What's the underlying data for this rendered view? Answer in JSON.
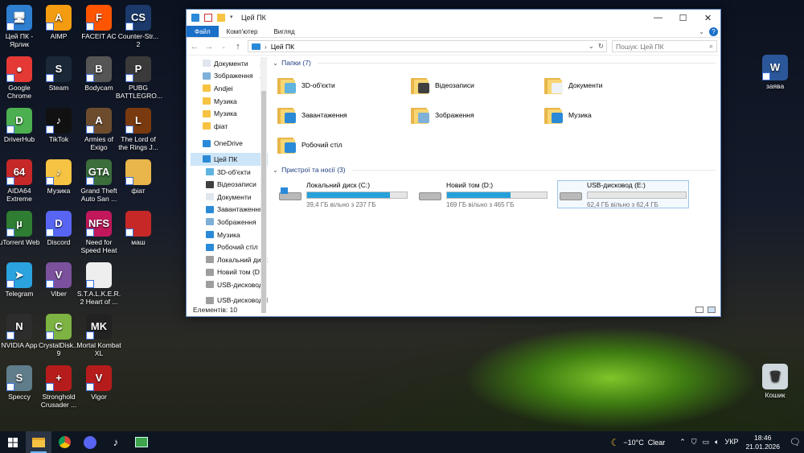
{
  "desktop": {
    "icons": [
      {
        "label": "Цей ПК - Ярлик",
        "color": "#2f7fd0",
        "glyph": "🖥"
      },
      {
        "label": "AIMP",
        "color": "#f39c12",
        "glyph": "A"
      },
      {
        "label": "FACEIT AC",
        "color": "#ff5500",
        "glyph": "F"
      },
      {
        "label": "Counter-Str... 2",
        "color": "#1b3a6b",
        "glyph": "CS"
      },
      {
        "label": "Google Chrome",
        "color": "#e53935",
        "glyph": "●"
      },
      {
        "label": "Steam",
        "color": "#1b2838",
        "glyph": "S"
      },
      {
        "label": "Bodycam",
        "color": "#555555",
        "glyph": "B"
      },
      {
        "label": "PUBG BATTLEGRO...",
        "color": "#3a3a3a",
        "glyph": "P"
      },
      {
        "label": "DriverHub",
        "color": "#4caf50",
        "glyph": "D"
      },
      {
        "label": "TikTok",
        "color": "#111111",
        "glyph": "♪"
      },
      {
        "label": "Armies of Exigo",
        "color": "#6d4c2e",
        "glyph": "A"
      },
      {
        "label": "The Lord of the Rings J...",
        "color": "#7a3a10",
        "glyph": "L"
      },
      {
        "label": "AIDA64 Extreme",
        "color": "#c62828",
        "glyph": "64"
      },
      {
        "label": "Музика",
        "color": "#f6c342",
        "glyph": "♪"
      },
      {
        "label": "Grand Theft Auto San ...",
        "color": "#3b6e3b",
        "glyph": "GTA"
      },
      {
        "label": "фіат",
        "color": "#e8b64a",
        "glyph": ""
      },
      {
        "label": "uTorrent Web",
        "color": "#2e7d32",
        "glyph": "µ"
      },
      {
        "label": "Discord",
        "color": "#5865f2",
        "glyph": "D"
      },
      {
        "label": "Need for Speed Heat",
        "color": "#c2185b",
        "glyph": "NFS"
      },
      {
        "label": "маш",
        "color": "#c62828",
        "glyph": ""
      },
      {
        "label": "Telegram",
        "color": "#2aa3df",
        "glyph": "➤"
      },
      {
        "label": "Viber",
        "color": "#7b519d",
        "glyph": "V"
      },
      {
        "label": "S.T.A.L.K.E.R. 2 Heart of ...",
        "color": "#eeeeee",
        "glyph": ""
      },
      {
        "label": "NVIDIA App",
        "color": "#2d2d2d",
        "glyph": "N"
      },
      {
        "label": "CrystalDisk... 9",
        "color": "#7cb342",
        "glyph": "C"
      },
      {
        "label": "Mortal Kombat XL",
        "color": "#222222",
        "glyph": "MK"
      },
      {
        "label": "Speccy",
        "color": "#607d8b",
        "glyph": "S"
      },
      {
        "label": "Stronghold Crusader ...",
        "color": "#b71c1c",
        "glyph": "+"
      },
      {
        "label": "Vigor",
        "color": "#b71c1c",
        "glyph": "V"
      },
      {
        "label": "заява",
        "color": "#2b579a",
        "glyph": "W"
      },
      {
        "label": "Кошик",
        "color": "#cfd8dc",
        "glyph": "🗑"
      }
    ]
  },
  "window": {
    "title": "Цей ПК",
    "tabs": [
      "Файл",
      "Комп'ютер",
      "Вигляд"
    ],
    "address": "Цей ПК",
    "search_placeholder": "Пошук: Цей ПК",
    "nav": [
      {
        "label": "Документи",
        "pinned": true,
        "color": "#dfe6ee"
      },
      {
        "label": "Зображення",
        "pinned": true,
        "color": "#7fb0d8"
      },
      {
        "label": "Andjei",
        "pinned": false,
        "color": "#f6c342"
      },
      {
        "label": "Музика",
        "pinned": false,
        "color": "#f6c342"
      },
      {
        "label": "Музика",
        "pinned": false,
        "color": "#f6c342"
      },
      {
        "label": "фіат",
        "pinned": false,
        "color": "#f6c342"
      },
      {
        "label": "OneDrive",
        "pinned": false,
        "color": "#2a8ad8"
      },
      {
        "label": "Цей ПК",
        "pinned": false,
        "color": "#2a8ad8"
      },
      {
        "label": "3D-об'єкти",
        "pinned": false,
        "color": "#5fb4e0"
      },
      {
        "label": "Відеозаписи",
        "pinned": false,
        "color": "#404040"
      },
      {
        "label": "Документи",
        "pinned": false,
        "color": "#dfe6ee"
      },
      {
        "label": "Завантаження",
        "pinned": false,
        "color": "#2a8ad8"
      },
      {
        "label": "Зображення",
        "pinned": false,
        "color": "#7fb0d8"
      },
      {
        "label": "Музика",
        "pinned": false,
        "color": "#2a8ad8"
      },
      {
        "label": "Робочий стіл",
        "pinned": false,
        "color": "#2a8ad8"
      },
      {
        "label": "Локальний диск",
        "pinned": false,
        "color": "#9e9e9e"
      },
      {
        "label": "Новий том (D:)",
        "pinned": false,
        "color": "#9e9e9e"
      },
      {
        "label": "USB-дисковод (",
        "pinned": false,
        "color": "#9e9e9e"
      },
      {
        "label": "USB-дисковод (E:)",
        "pinned": false,
        "color": "#9e9e9e"
      }
    ],
    "folders_header": "Папки (7)",
    "folders": [
      {
        "label": "3D-об'єкти",
        "overlay": "#5fb4e0"
      },
      {
        "label": "Відеозаписи",
        "overlay": "#404040"
      },
      {
        "label": "Документи",
        "overlay": "#eef2f6"
      },
      {
        "label": "Завантаження",
        "overlay": "#2a8ad8"
      },
      {
        "label": "Зображення",
        "overlay": "#7fb0d8"
      },
      {
        "label": "Музика",
        "overlay": "#2a8ad8"
      },
      {
        "label": "Робочий стіл",
        "overlay": "#2a8ad8"
      }
    ],
    "devices_header": "Пристрої та носії (3)",
    "drives": [
      {
        "label": "Локальний диск (C:)",
        "free": "39,4 ГБ вільно з 237 ГБ",
        "used_fraction": 0.834,
        "windows": true
      },
      {
        "label": "Новий том (D:)",
        "free": "169 ГБ вільно з 465 ГБ",
        "used_fraction": 0.637,
        "windows": false
      },
      {
        "label": "USB-дисковод (E:)",
        "free": "62,4 ГБ вільно з 62,4 ГБ",
        "used_fraction": 0.0,
        "windows": false
      }
    ],
    "status": "Елементів: 10"
  },
  "taskbar": {
    "weather_temp": "−10°C",
    "weather_text": "Clear",
    "lang": "УКР",
    "time": "18:46",
    "date": "21.01.2026"
  }
}
